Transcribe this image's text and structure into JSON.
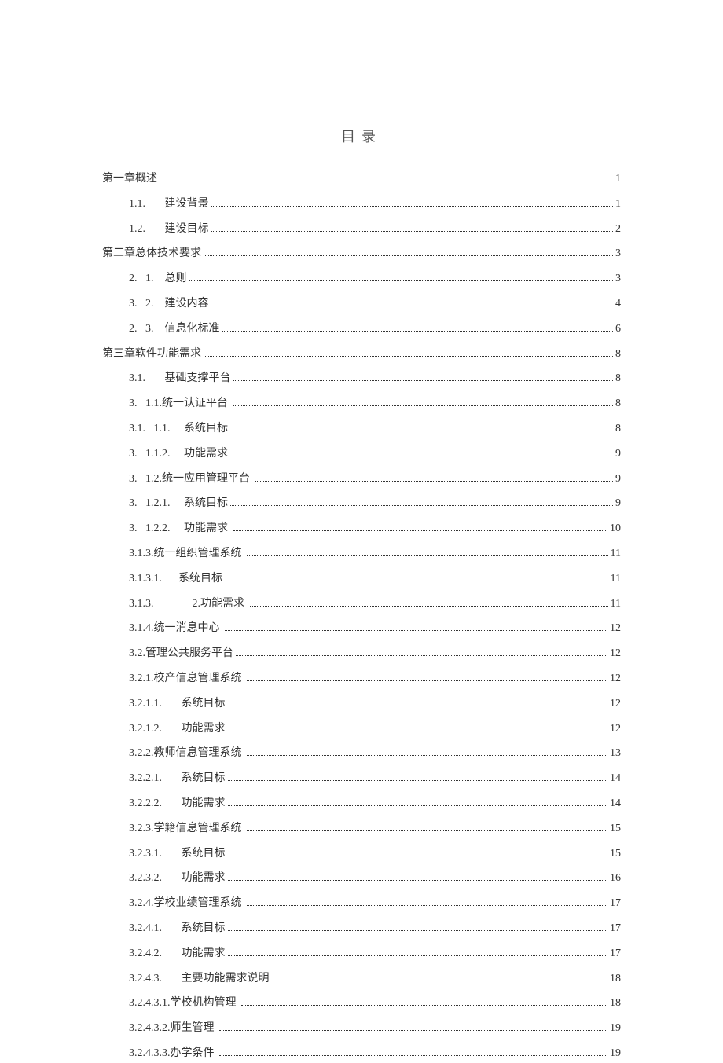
{
  "title": "目录",
  "entries": [
    {
      "indent": 0,
      "label": "第一章概述",
      "page": "1"
    },
    {
      "indent": 1,
      "label": "1.1.       建设背景",
      "page": "1"
    },
    {
      "indent": 1,
      "label": "1.2.       建设目标",
      "page": "2"
    },
    {
      "indent": 0,
      "label": "第二章总体技术要求",
      "page": "3"
    },
    {
      "indent": 1,
      "label": "2.   1.    总则",
      "page": "3"
    },
    {
      "indent": 1,
      "label": "3.   2.    建设内容",
      "page": "4"
    },
    {
      "indent": 1,
      "label": "2.   3.    信息化标准",
      "page": "6"
    },
    {
      "indent": 0,
      "label": "第三章软件功能需求",
      "page": "8"
    },
    {
      "indent": 1,
      "label": "3.1.       基础支撑平台",
      "page": "8"
    },
    {
      "indent": 1,
      "label": "3.   1.1.统一认证平台 ",
      "page": "8"
    },
    {
      "indent": 1,
      "label": "3.1.   1.1.     系统目标",
      "page": "8"
    },
    {
      "indent": 1,
      "label": "3.   1.1.2.     功能需求",
      "page": "9"
    },
    {
      "indent": 1,
      "label": "3.   1.2.统一应用管理平台 ",
      "page": "9"
    },
    {
      "indent": 1,
      "label": "3.   1.2.1.     系统目标",
      "page": "9"
    },
    {
      "indent": 1,
      "label": "3.   1.2.2.     功能需求 ",
      "page": "10"
    },
    {
      "indent": 1,
      "label": "3.1.3.统一组织管理系统 ",
      "page": "11"
    },
    {
      "indent": 1,
      "label": "3.1.3.1.      系统目标 ",
      "page": "11"
    },
    {
      "indent": 1,
      "label": "3.1.3.              2.功能需求 ",
      "page": "11"
    },
    {
      "indent": 1,
      "label": "3.1.4.统一消息中心 ",
      "page": "12"
    },
    {
      "indent": 1,
      "label": "3.2.管理公共服务平台",
      "page": "12"
    },
    {
      "indent": 1,
      "label": "3.2.1.校产信息管理系统 ",
      "page": "12"
    },
    {
      "indent": 1,
      "label": "3.2.1.1.       系统目标",
      "page": "12"
    },
    {
      "indent": 1,
      "label": "3.2.1.2.       功能需求",
      "page": "12"
    },
    {
      "indent": 1,
      "label": "3.2.2.教师信息管理系统 ",
      "page": "13"
    },
    {
      "indent": 1,
      "label": "3.2.2.1.       系统目标",
      "page": "14"
    },
    {
      "indent": 1,
      "label": "3.2.2.2.       功能需求",
      "page": "14"
    },
    {
      "indent": 1,
      "label": "3.2.3.学籍信息管理系统 ",
      "page": "15"
    },
    {
      "indent": 1,
      "label": "3.2.3.1.       系统目标",
      "page": "15"
    },
    {
      "indent": 1,
      "label": "3.2.3.2.       功能需求",
      "page": "16"
    },
    {
      "indent": 1,
      "label": "3.2.4.学校业绩管理系统 ",
      "page": "17"
    },
    {
      "indent": 1,
      "label": "3.2.4.1.       系统目标",
      "page": "17"
    },
    {
      "indent": 1,
      "label": "3.2.4.2.       功能需求",
      "page": "17"
    },
    {
      "indent": 1,
      "label": "3.2.4.3.       主要功能需求说明 ",
      "page": "18"
    },
    {
      "indent": 1,
      "label": "3.2.4.3.1.学校机构管理 ",
      "page": "18"
    },
    {
      "indent": 1,
      "label": "3.2.4.3.2.师生管理 ",
      "page": "19"
    },
    {
      "indent": 1,
      "label": "3.2.4.3.3.办学条件 ",
      "page": "19"
    }
  ]
}
